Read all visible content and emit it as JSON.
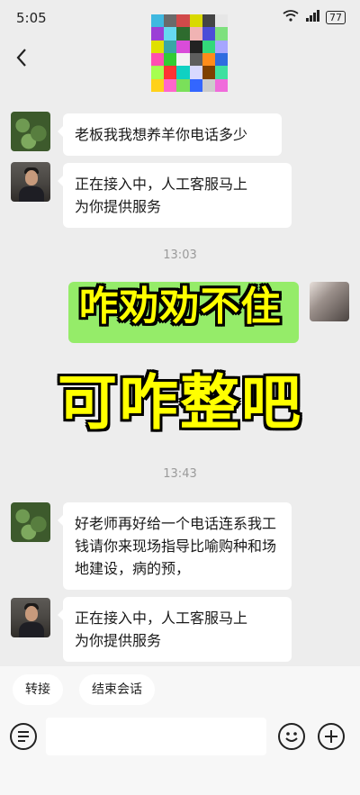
{
  "status_bar": {
    "time": "5:05",
    "signal_text": "4G",
    "battery": "77"
  },
  "header": {
    "back_icon": "chevron-left-icon",
    "avatar_description": "pixelated-avatar"
  },
  "messages": [
    {
      "sender": "customer",
      "text": "老板我我想养羊你电话多少"
    },
    {
      "sender": "agent",
      "lines": [
        "正在接入中，人工客服马上",
        "为你提供服务"
      ]
    },
    {
      "sender": "customer",
      "text": "好老师再好给一个电话连系我工钱请你来现场指导比喻购种和场地建设，病的预，"
    },
    {
      "sender": "agent",
      "lines": [
        "正在接入中，人工客服马上",
        "为你提供服务"
      ]
    }
  ],
  "timestamps": [
    "13:03",
    "13:43"
  ],
  "overlay": {
    "line1": "咋劝劝不住",
    "line2": "可咋整吧"
  },
  "quick_actions": [
    "转接",
    "结束会话"
  ],
  "input": {
    "placeholder": ""
  },
  "colors": {
    "background": "#ededed",
    "bubble_white": "#ffffff",
    "bubble_green": "#95ec69",
    "overlay_text": "#ffff00"
  }
}
